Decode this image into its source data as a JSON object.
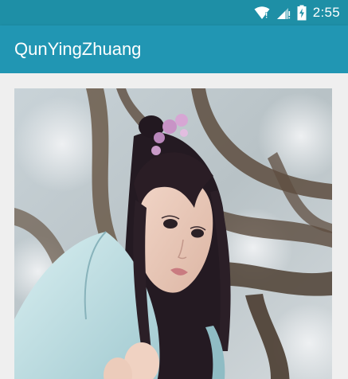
{
  "status_bar": {
    "time": "2:55",
    "background_color": "#1e8fa6",
    "icons": [
      "wifi-icon",
      "cellular-signal-icon",
      "battery-charging-icon"
    ]
  },
  "app_bar": {
    "title": "QunYingZhuang",
    "background_color": "#2196b3"
  },
  "main": {
    "image": {
      "icon": "portrait-photo"
    }
  }
}
